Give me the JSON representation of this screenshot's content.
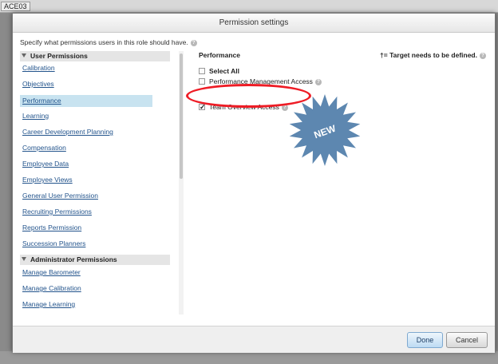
{
  "background": {
    "tag": "ACE03"
  },
  "dialog": {
    "title": "Permission settings",
    "intro": "Specify what permissions users in this role should have.",
    "sidebar": {
      "sections": [
        {
          "label": "User Permissions",
          "items": [
            "Calibration",
            "Objectives",
            "Performance",
            "Learning",
            "Career Development Planning",
            "Compensation",
            "Employee Data",
            "Employee Views",
            "General User Permission",
            "Recruiting Permissions",
            "Reports Permission",
            "Succession Planners"
          ]
        },
        {
          "label": "Administrator Permissions",
          "items": [
            "Manage Barometer",
            "Manage Calibration",
            "Manage Learning"
          ]
        }
      ],
      "active_item": "Performance"
    },
    "main": {
      "title": "Performance",
      "target_note": "†= Target needs to be defined.",
      "options": [
        {
          "label": "Select All",
          "checked": false
        },
        {
          "label": "Performance Management Access",
          "checked": false
        },
        {
          "label": "Team Overview Access",
          "checked": true
        }
      ]
    },
    "callout": {
      "text": "NEW",
      "color": "#5d87b0",
      "highlight_color": "#ee1c25"
    },
    "footer": {
      "done_label": "Done",
      "cancel_label": "Cancel"
    }
  }
}
